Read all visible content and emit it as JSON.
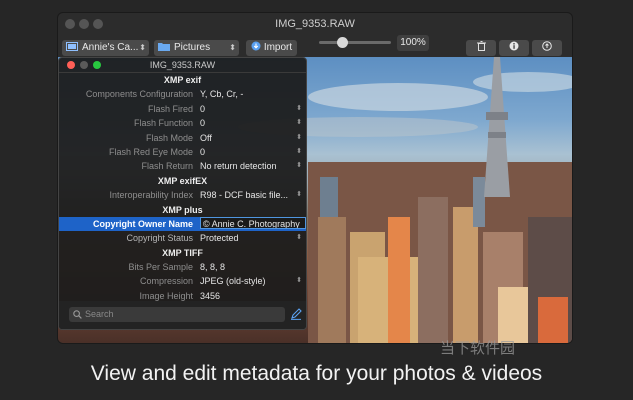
{
  "window": {
    "title": "IMG_9353.RAW"
  },
  "toolbar": {
    "library_label": "Annie's Ca...",
    "folder_label": "Pictures",
    "import_label": "Import",
    "zoom_value": "100%",
    "zoom_slider_fraction": 0.32
  },
  "panel": {
    "title": "IMG_9353.RAW",
    "search_placeholder": "Search",
    "sections": [
      {
        "header": "XMP exif",
        "rows": [
          {
            "label": "Components Configuration",
            "value": "Y, Cb, Cr, -",
            "stepper": false
          },
          {
            "label": "Flash Fired",
            "value": "0",
            "stepper": true
          },
          {
            "label": "Flash Function",
            "value": "0",
            "stepper": true
          },
          {
            "label": "Flash Mode",
            "value": "Off",
            "stepper": true
          },
          {
            "label": "Flash Red Eye Mode",
            "value": "0",
            "stepper": true
          },
          {
            "label": "Flash Return",
            "value": "No return detection",
            "stepper": true
          }
        ]
      },
      {
        "header": "XMP exifEX",
        "rows": [
          {
            "label": "Interoperability Index",
            "value": "R98 - DCF basic file...",
            "stepper": true
          }
        ]
      },
      {
        "header": "XMP plus",
        "rows": [
          {
            "label": "Copyright Owner Name",
            "value": "© Annie C. Photography",
            "stepper": false,
            "selected": true
          },
          {
            "label": "Copyright Status",
            "value": "Protected",
            "stepper": true,
            "bold": true
          }
        ]
      },
      {
        "header": "XMP TIFF",
        "rows": [
          {
            "label": "Bits Per Sample",
            "value": "8, 8, 8",
            "stepper": false
          },
          {
            "label": "Compression",
            "value": "JPEG (old-style)",
            "stepper": true
          },
          {
            "label": "Image Height",
            "value": "3456",
            "stepper": false
          }
        ]
      }
    ]
  },
  "caption": "View and edit metadata for your photos & videos",
  "watermark": "当下软件园",
  "colors": {
    "selection": "#1e63c8",
    "window_bg": "#2c2c2c",
    "panel_bg": "#1c1c1c"
  }
}
